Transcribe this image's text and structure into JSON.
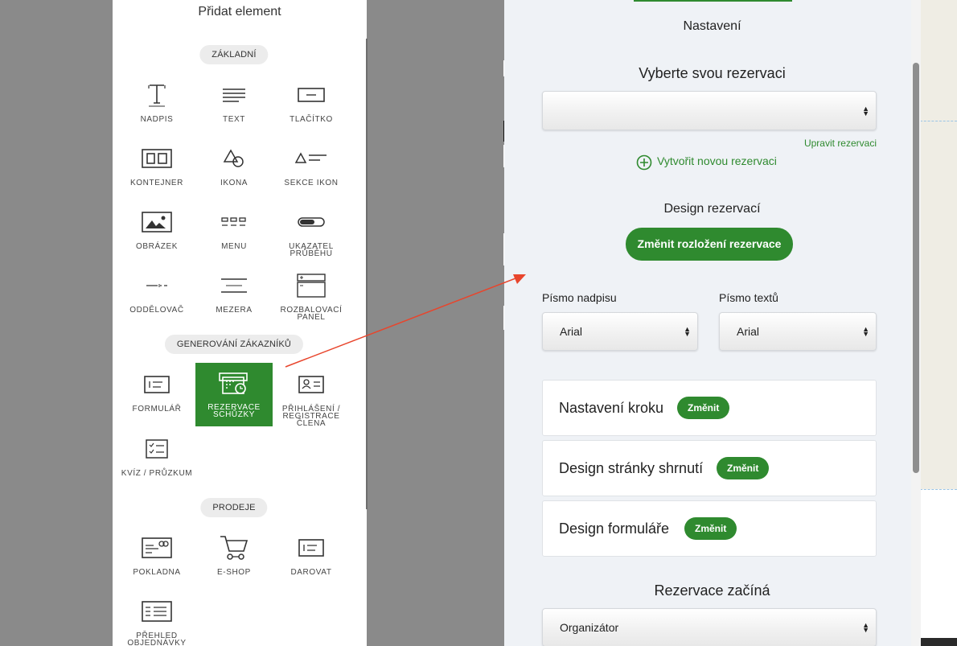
{
  "left_panel": {
    "title": "Přidat element",
    "sections": {
      "basic": "ZÁKLADNÍ",
      "leads": "GENEROVÁNÍ ZÁKAZNÍKŮ",
      "sales": "PRODEJE"
    },
    "tiles": {
      "heading": "NADPIS",
      "text": "TEXT",
      "button": "TLAČÍTKO",
      "container": "KONTEJNER",
      "icon": "IKONA",
      "icon_section": "SEKCE IKON",
      "image": "OBRÁZEK",
      "menu": "MENU",
      "progress": "UKAZATEL PRŮBĚHU",
      "divider": "ODDĚLOVAČ",
      "spacer": "MEZERA",
      "accordion": "ROZBALOVACÍ PANEL",
      "form": "FORMULÁŘ",
      "booking": "REZERVACE SCHŮZKY",
      "login": "PŘIHLÁŠENÍ / REGISTRACE ČLENA",
      "quiz": "KVÍZ / PRŮZKUM",
      "checkout": "POKLADNA",
      "eshop": "E-SHOP",
      "donate": "DAROVAT",
      "orders": "PŘEHLED OBJEDNÁVKY"
    },
    "active_tile": "booking"
  },
  "right_panel": {
    "header": "Nastavení",
    "select_booking_label": "Vyberte svou rezervaci",
    "booking_select_value": "",
    "edit_link": "Upravit rezervaci",
    "create_new": "Vytvořit novou rezervaci",
    "design_heading": "Design rezervací",
    "change_layout_button": "Změnit rozložení rezervace",
    "heading_font_label": "Písmo nadpisu",
    "heading_font_value": "Arial",
    "text_font_label": "Písmo textů",
    "text_font_value": "Arial",
    "cards": [
      {
        "title": "Nastavení kroku",
        "button": "Změnit"
      },
      {
        "title": "Design stránky shrnutí",
        "button": "Změnit"
      },
      {
        "title": "Design formuláře",
        "button": "Změnit"
      }
    ],
    "starts_label": "Rezervace začíná",
    "starts_value": "Organizátor"
  },
  "colors": {
    "accent": "#2f8a2f",
    "arrow": "#e8452c",
    "panel_bg": "#eff2f6",
    "backdrop": "#8a8a8a"
  }
}
